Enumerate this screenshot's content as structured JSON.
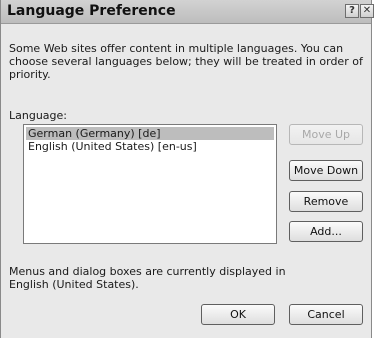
{
  "window": {
    "title": "Language Preference",
    "help_glyph": "?",
    "close_glyph": "✕"
  },
  "description": "Some Web sites offer content in multiple languages. You can choose several languages below; they will be treated in order of priority.",
  "language_label": "Language:",
  "languages": [
    {
      "label": "German (Germany) [de]",
      "selected": true
    },
    {
      "label": "English (United States) [en-us]",
      "selected": false
    }
  ],
  "buttons": {
    "move_up": "Move Up",
    "move_down": "Move Down",
    "remove": "Remove",
    "add": "Add...",
    "ok": "OK",
    "cancel": "Cancel"
  },
  "footer_text": "Menus and dialog boxes are currently displayed in English (United States)."
}
